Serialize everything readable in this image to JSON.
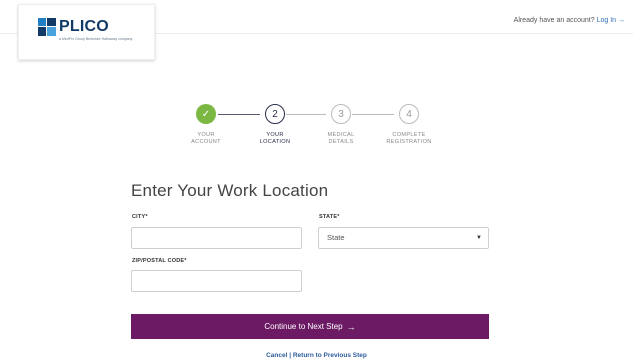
{
  "header": {
    "logo_text": "PLICO",
    "logo_subtitle": "a MedPro Group Berkshire Hathaway company",
    "login_prompt": "Already have an account?",
    "login_link": "Log In",
    "login_arrow": "→"
  },
  "steps": [
    {
      "number": "✓",
      "label_line1": "YOUR",
      "label_line2": "ACCOUNT",
      "state": "done"
    },
    {
      "number": "2",
      "label_line1": "YOUR",
      "label_line2": "LOCATION",
      "state": "current"
    },
    {
      "number": "3",
      "label_line1": "MEDICAL",
      "label_line2": "DETAILS",
      "state": "todo"
    },
    {
      "number": "4",
      "label_line1": "COMPLETE",
      "label_line2": "REGISTRATION",
      "state": "todo"
    }
  ],
  "form": {
    "title": "Enter Your Work Location",
    "city_label": "CITY*",
    "city_value": "",
    "state_label": "STATE*",
    "state_value": "State",
    "zip_label": "ZIP/POSTAL CODE*",
    "zip_value": ""
  },
  "actions": {
    "continue_label": "Continue to Next Step",
    "continue_arrow": "→",
    "cancel_label": "Cancel | Return to Previous Step"
  },
  "colors": {
    "accent": "#6b1a63",
    "link": "#2d6fb4",
    "step_done": "#7bb843",
    "brand_navy": "#123a66"
  }
}
